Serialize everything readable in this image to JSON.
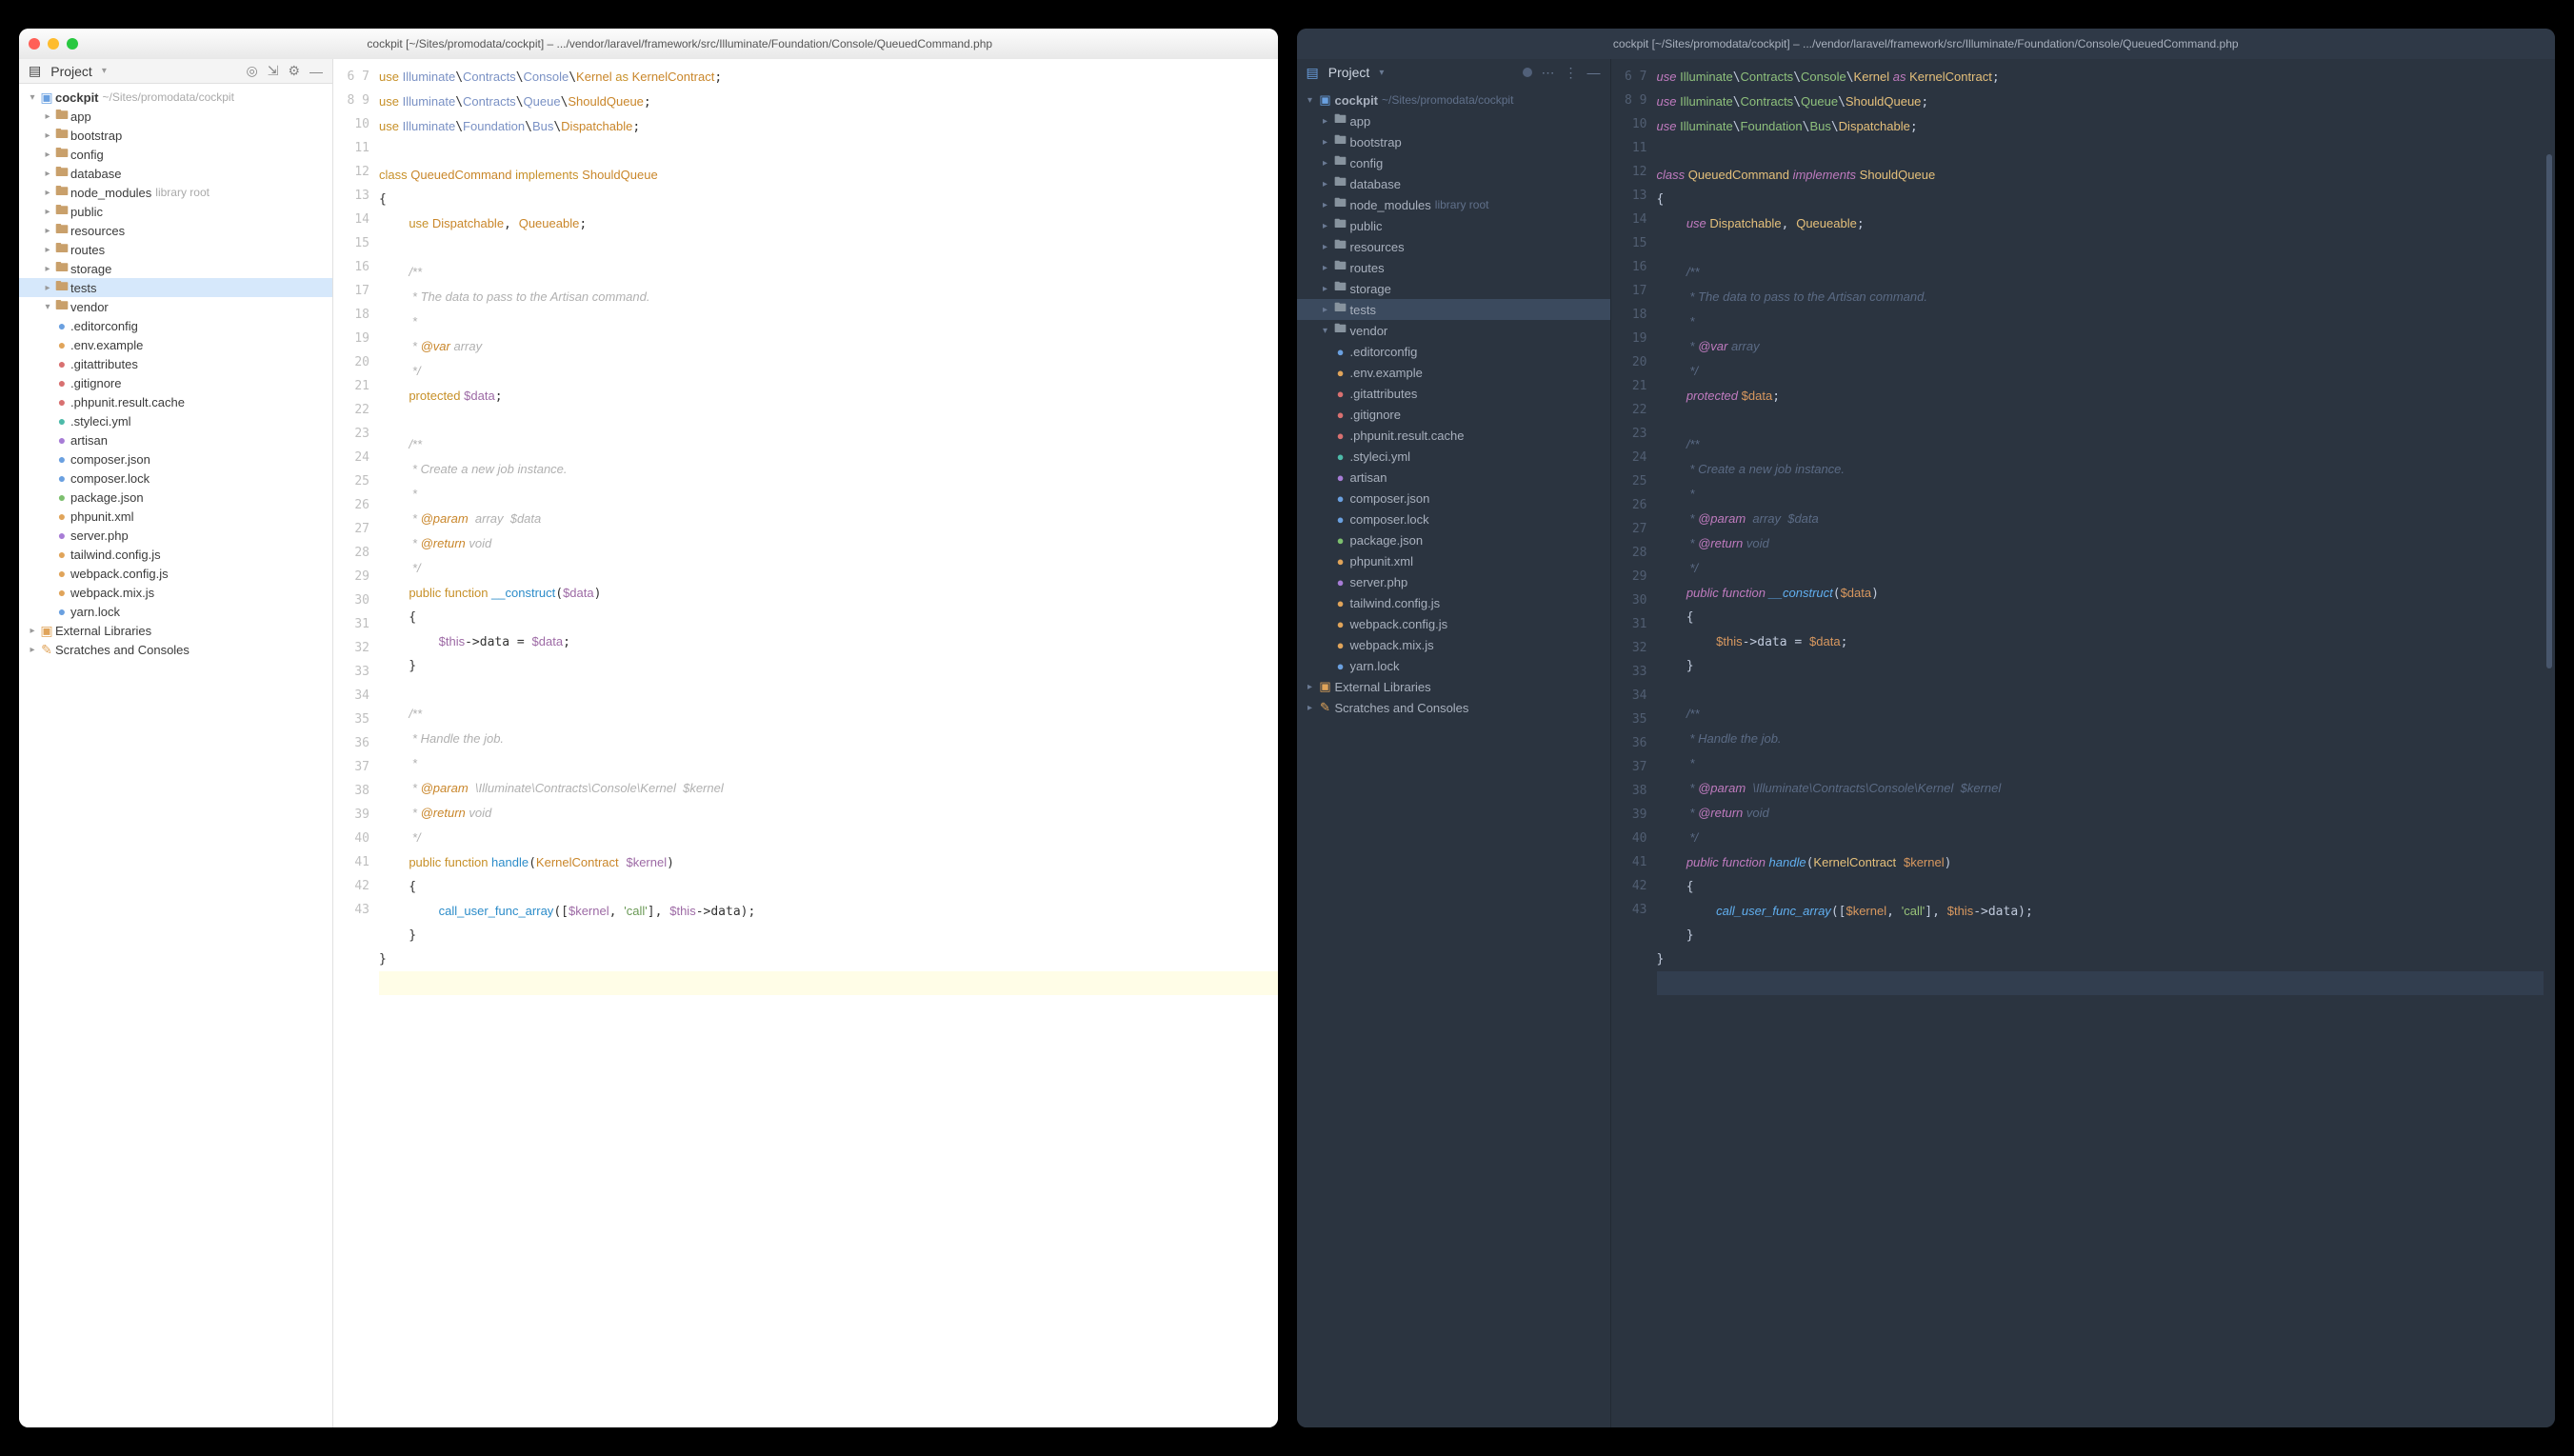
{
  "windowTitle": "cockpit [~/Sites/promodata/cockpit] – .../vendor/laravel/framework/src/Illuminate/Foundation/Console/QueuedCommand.php",
  "projectLabel": "Project",
  "rootName": "cockpit",
  "rootHint": "~/Sites/promodata/cockpit",
  "tree": [
    {
      "d": 1,
      "t": "folder",
      "n": "app"
    },
    {
      "d": 1,
      "t": "folder",
      "n": "bootstrap"
    },
    {
      "d": 1,
      "t": "folder",
      "n": "config"
    },
    {
      "d": 1,
      "t": "folder",
      "n": "database"
    },
    {
      "d": 1,
      "t": "folder",
      "n": "node_modules",
      "hint": "library root"
    },
    {
      "d": 1,
      "t": "folder",
      "n": "public"
    },
    {
      "d": 1,
      "t": "folder",
      "n": "resources"
    },
    {
      "d": 1,
      "t": "folder",
      "n": "routes"
    },
    {
      "d": 1,
      "t": "folder",
      "n": "storage"
    },
    {
      "d": 1,
      "t": "folder",
      "n": "tests",
      "sel": true
    },
    {
      "d": 1,
      "t": "folder",
      "n": "vendor",
      "open": true
    },
    {
      "d": 1,
      "t": "file",
      "n": ".editorconfig",
      "c": "file-blue"
    },
    {
      "d": 1,
      "t": "file",
      "n": ".env.example",
      "c": "file-orange"
    },
    {
      "d": 1,
      "t": "file",
      "n": ".gitattributes",
      "c": "file-red"
    },
    {
      "d": 1,
      "t": "file",
      "n": ".gitignore",
      "c": "file-red"
    },
    {
      "d": 1,
      "t": "file",
      "n": ".phpunit.result.cache",
      "c": "file-red"
    },
    {
      "d": 1,
      "t": "file",
      "n": ".styleci.yml",
      "c": "file-teal"
    },
    {
      "d": 1,
      "t": "file",
      "n": "artisan",
      "c": "file-purple"
    },
    {
      "d": 1,
      "t": "file",
      "n": "composer.json",
      "c": "file-blue"
    },
    {
      "d": 1,
      "t": "file",
      "n": "composer.lock",
      "c": "file-blue"
    },
    {
      "d": 1,
      "t": "file",
      "n": "package.json",
      "c": "file-green"
    },
    {
      "d": 1,
      "t": "file",
      "n": "phpunit.xml",
      "c": "file-orange"
    },
    {
      "d": 1,
      "t": "file",
      "n": "server.php",
      "c": "file-purple"
    },
    {
      "d": 1,
      "t": "file",
      "n": "tailwind.config.js",
      "c": "file-orange"
    },
    {
      "d": 1,
      "t": "file",
      "n": "webpack.config.js",
      "c": "file-orange"
    },
    {
      "d": 1,
      "t": "file",
      "n": "webpack.mix.js",
      "c": "file-orange"
    },
    {
      "d": 1,
      "t": "file",
      "n": "yarn.lock",
      "c": "file-blue"
    }
  ],
  "treeTail": [
    {
      "d": 0,
      "t": "lib",
      "n": "External Libraries"
    },
    {
      "d": 0,
      "t": "scratch",
      "n": "Scratches and Consoles"
    }
  ],
  "code": {
    "start": 6,
    "cursorLine": 43,
    "lines": [
      [
        [
          "k",
          "use "
        ],
        [
          "ns",
          "Illuminate"
        ],
        [
          "",
          "\\"
        ],
        [
          "ns",
          "Contracts"
        ],
        [
          "",
          "\\"
        ],
        [
          "ns",
          "Console"
        ],
        [
          "",
          "\\"
        ],
        [
          "cl",
          "Kernel"
        ],
        [
          "k",
          " as "
        ],
        [
          "cl",
          "KernelContract"
        ],
        [
          "",
          ";"
        ]
      ],
      [
        [
          "k",
          "use "
        ],
        [
          "ns",
          "Illuminate"
        ],
        [
          "",
          "\\"
        ],
        [
          "ns",
          "Contracts"
        ],
        [
          "",
          "\\"
        ],
        [
          "ns",
          "Queue"
        ],
        [
          "",
          "\\"
        ],
        [
          "cl",
          "ShouldQueue"
        ],
        [
          "",
          ";"
        ]
      ],
      [
        [
          "k",
          "use "
        ],
        [
          "ns",
          "Illuminate"
        ],
        [
          "",
          "\\"
        ],
        [
          "ns",
          "Foundation"
        ],
        [
          "",
          "\\"
        ],
        [
          "ns",
          "Bus"
        ],
        [
          "",
          "\\"
        ],
        [
          "cl",
          "Dispatchable"
        ],
        [
          "",
          ";"
        ]
      ],
      [
        [
          "",
          ""
        ]
      ],
      [
        [
          "k",
          "class "
        ],
        [
          "cl",
          "QueuedCommand"
        ],
        [
          "k",
          " implements "
        ],
        [
          "cl",
          "ShouldQueue"
        ]
      ],
      [
        [
          "",
          "{"
        ]
      ],
      [
        [
          "",
          "    "
        ],
        [
          "k",
          "use "
        ],
        [
          "cl",
          "Dispatchable"
        ],
        [
          "",
          ", "
        ],
        [
          "cl",
          "Queueable"
        ],
        [
          "",
          ";"
        ]
      ],
      [
        [
          "",
          ""
        ]
      ],
      [
        [
          "",
          "    "
        ],
        [
          "co",
          "/**"
        ]
      ],
      [
        [
          "",
          "    "
        ],
        [
          "co",
          " * The data to pass to the Artisan command."
        ]
      ],
      [
        [
          "",
          "    "
        ],
        [
          "co",
          " *"
        ]
      ],
      [
        [
          "",
          "    "
        ],
        [
          "co",
          " * "
        ],
        [
          "at",
          "@var"
        ],
        [
          "co",
          " array"
        ]
      ],
      [
        [
          "",
          "    "
        ],
        [
          "co",
          " */"
        ]
      ],
      [
        [
          "",
          "    "
        ],
        [
          "k",
          "protected "
        ],
        [
          "va",
          "$data"
        ],
        [
          "",
          ";"
        ]
      ],
      [
        [
          "",
          ""
        ]
      ],
      [
        [
          "",
          "    "
        ],
        [
          "co",
          "/**"
        ]
      ],
      [
        [
          "",
          "    "
        ],
        [
          "co",
          " * Create a new job instance."
        ]
      ],
      [
        [
          "",
          "    "
        ],
        [
          "co",
          " *"
        ]
      ],
      [
        [
          "",
          "    "
        ],
        [
          "co",
          " * "
        ],
        [
          "at",
          "@param"
        ],
        [
          "co",
          "  array  $data"
        ]
      ],
      [
        [
          "",
          "    "
        ],
        [
          "co",
          " * "
        ],
        [
          "at",
          "@return"
        ],
        [
          "co",
          " void"
        ]
      ],
      [
        [
          "",
          "    "
        ],
        [
          "co",
          " */"
        ]
      ],
      [
        [
          "",
          "    "
        ],
        [
          "k",
          "public "
        ],
        [
          "k",
          "function "
        ],
        [
          "fn",
          "__construct"
        ],
        [
          "",
          "("
        ],
        [
          "va",
          "$data"
        ],
        [
          "",
          ")"
        ]
      ],
      [
        [
          "",
          "    {"
        ]
      ],
      [
        [
          "",
          "        "
        ],
        [
          "va",
          "$this"
        ],
        [
          "",
          "->"
        ],
        [
          "",
          "data = "
        ],
        [
          "va",
          "$data"
        ],
        [
          "",
          ";"
        ]
      ],
      [
        [
          "",
          "    }"
        ]
      ],
      [
        [
          "",
          ""
        ]
      ],
      [
        [
          "",
          "    "
        ],
        [
          "co",
          "/**"
        ]
      ],
      [
        [
          "",
          "    "
        ],
        [
          "co",
          " * Handle the job."
        ]
      ],
      [
        [
          "",
          "    "
        ],
        [
          "co",
          " *"
        ]
      ],
      [
        [
          "",
          "    "
        ],
        [
          "co",
          " * "
        ],
        [
          "at",
          "@param"
        ],
        [
          "co",
          "  \\Illuminate\\Contracts\\Console\\Kernel  $kernel"
        ]
      ],
      [
        [
          "",
          "    "
        ],
        [
          "co",
          " * "
        ],
        [
          "at",
          "@return"
        ],
        [
          "co",
          " void"
        ]
      ],
      [
        [
          "",
          "    "
        ],
        [
          "co",
          " */"
        ]
      ],
      [
        [
          "",
          "    "
        ],
        [
          "k",
          "public "
        ],
        [
          "k",
          "function "
        ],
        [
          "fn",
          "handle"
        ],
        [
          "",
          "("
        ],
        [
          "cl",
          "KernelContract"
        ],
        [
          "",
          " "
        ],
        [
          "va",
          "$kernel"
        ],
        [
          "",
          ")"
        ]
      ],
      [
        [
          "",
          "    {"
        ]
      ],
      [
        [
          "",
          "        "
        ],
        [
          "fn",
          "call_user_func_array"
        ],
        [
          "",
          "(["
        ],
        [
          "va",
          "$kernel"
        ],
        [
          "",
          ", "
        ],
        [
          "st",
          "'call'"
        ],
        [
          "",
          "], "
        ],
        [
          "va",
          "$this"
        ],
        [
          "",
          "->"
        ],
        [
          "",
          "data);"
        ]
      ],
      [
        [
          "",
          "    }"
        ]
      ],
      [
        [
          "",
          "}"
        ]
      ],
      [
        [
          "",
          ""
        ]
      ]
    ]
  }
}
